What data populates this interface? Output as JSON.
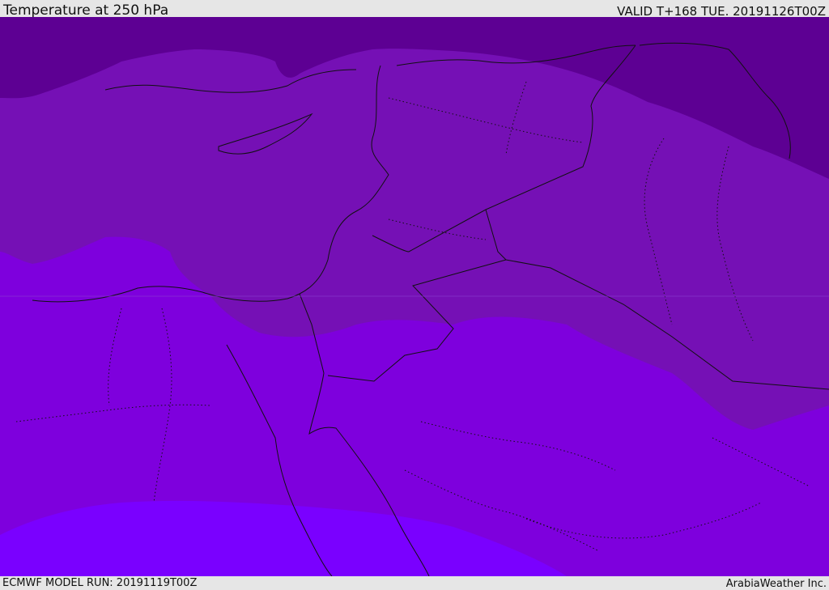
{
  "header": {
    "title": "Temperature at 250 hPa",
    "valid": "VALID T+168 TUE. 20191126T00Z"
  },
  "footer": {
    "model_run": "ECMWF MODEL RUN: 20191119T00Z",
    "credit": "ArabiaWeather Inc."
  },
  "map": {
    "colors": {
      "coldest_band": "#5d0093",
      "cold_band": "#7510b5",
      "warm_band": "#7e00dd",
      "warmest_band": "#7a00ff",
      "border_line": "#111111"
    }
  }
}
